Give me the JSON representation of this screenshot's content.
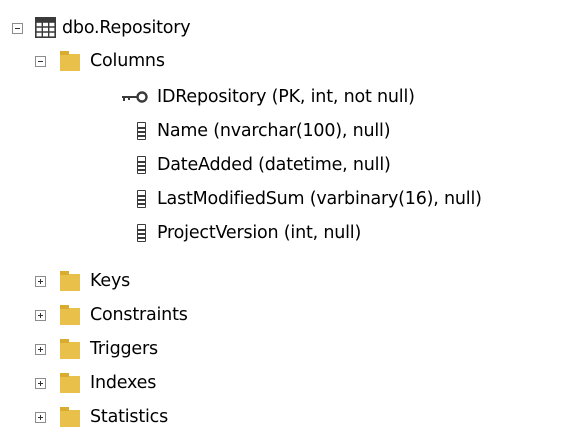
{
  "tree": {
    "table": {
      "label": "dbo.Repository",
      "expanded": true,
      "icon": "table-icon"
    },
    "columns_folder": {
      "label": "Columns",
      "expanded": true,
      "icon": "folder-icon"
    },
    "columns": [
      {
        "label": "IDRepository (PK, int, not null)",
        "icon": "key-icon"
      },
      {
        "label": "Name (nvarchar(100), null)",
        "icon": "column-icon"
      },
      {
        "label": "DateAdded (datetime, null)",
        "icon": "column-icon"
      },
      {
        "label": "LastModifiedSum (varbinary(16), null)",
        "icon": "column-icon"
      },
      {
        "label": "ProjectVersion (int, null)",
        "icon": "column-icon"
      }
    ],
    "folders": [
      {
        "label": "Keys",
        "expanded": false
      },
      {
        "label": "Constraints",
        "expanded": false
      },
      {
        "label": "Triggers",
        "expanded": false
      },
      {
        "label": "Indexes",
        "expanded": false
      },
      {
        "label": "Statistics",
        "expanded": false
      }
    ]
  },
  "colors": {
    "folder": "#e8c04a",
    "table_grid": "#3a3a3a",
    "background": "#ffffff"
  }
}
